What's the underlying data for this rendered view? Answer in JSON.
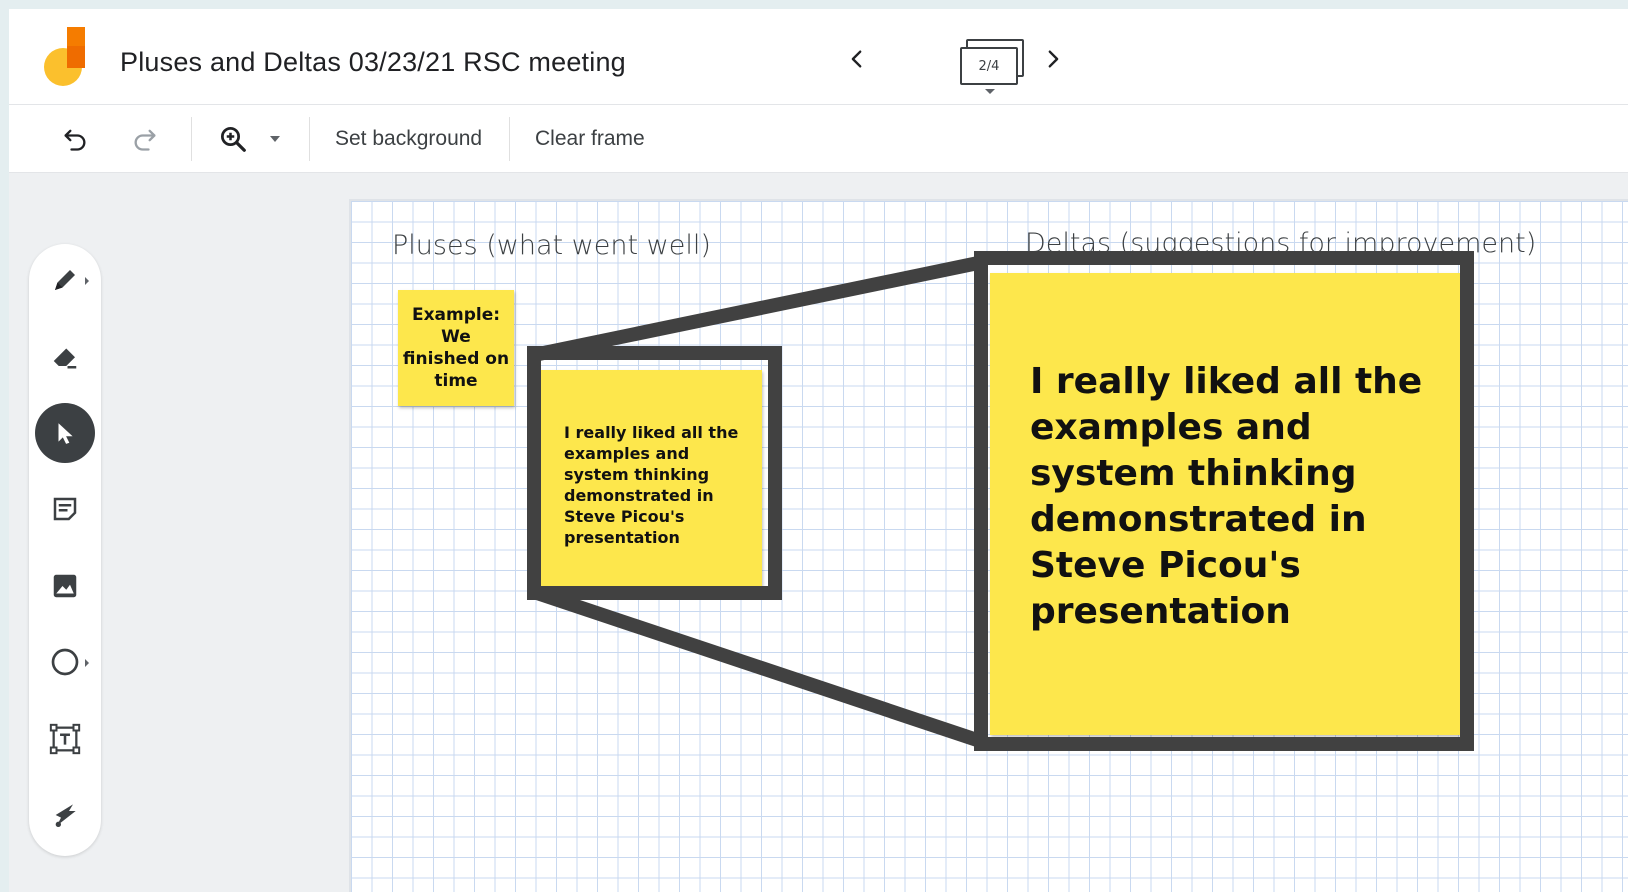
{
  "titlebar": {
    "title": "Pluses and Deltas 03/23/21 RSC meeting",
    "frame_indicator": "2/4",
    "prev_icon": "chevron-left-icon",
    "next_icon": "chevron-right-icon"
  },
  "toolbar": {
    "undo_icon": "undo-icon",
    "redo_icon": "redo-icon",
    "zoom_icon": "zoom-in-icon",
    "set_background_label": "Set background",
    "clear_frame_label": "Clear frame"
  },
  "tools": [
    {
      "name": "pen",
      "icon": "pen-icon"
    },
    {
      "name": "eraser",
      "icon": "eraser-icon"
    },
    {
      "name": "select",
      "icon": "select-arrow-icon",
      "active": true
    },
    {
      "name": "sticky-note",
      "icon": "sticky-note-icon"
    },
    {
      "name": "image",
      "icon": "image-icon"
    },
    {
      "name": "circle",
      "icon": "circle-icon"
    },
    {
      "name": "text-box",
      "icon": "text-box-icon"
    },
    {
      "name": "laser",
      "icon": "laser-icon"
    }
  ],
  "board": {
    "pluses_heading": "Pluses (what went well)",
    "deltas_heading": "Deltas (suggestions for improvement)",
    "sticky_example": "Example: We finished on time",
    "sticky_comment": "I really liked all the examples and system thinking demonstrated in Steve Picou's presentation",
    "sticky_comment_zoomed": "I really liked all the examples and system thinking demonstrated in Steve Picou's presentation"
  },
  "colors": {
    "sticky_yellow": "#fde74c",
    "callout_gray": "#414141",
    "active_tool": "#3c4043",
    "logo_orange": "#f57c00",
    "logo_yellow": "#fbc02d"
  }
}
